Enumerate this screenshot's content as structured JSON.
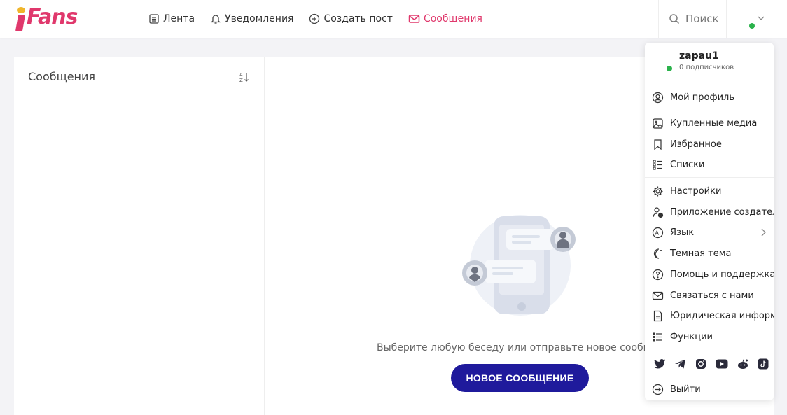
{
  "brand": {
    "logo_text": "Fans",
    "accent": "#e0386c",
    "button_color": "#1f1a9c",
    "online_color": "#2bb24c"
  },
  "nav": {
    "items": [
      {
        "label": "Лента",
        "icon": "feed-icon"
      },
      {
        "label": "Уведомления",
        "icon": "bell-icon"
      },
      {
        "label": "Создать пост",
        "icon": "plus-circle-icon"
      },
      {
        "label": "Сообщения",
        "icon": "envelope-icon",
        "active": true
      }
    ],
    "search_label": "Поиск"
  },
  "messages_panel": {
    "title": "Сообщения"
  },
  "empty_state": {
    "text": "Выберите любую беседу или отправьте новое сообщение",
    "button_label": "НОВОЕ СООБЩЕНИЕ"
  },
  "dropdown": {
    "username": "zapau1",
    "followers": "0 подписчиков",
    "items": [
      {
        "label": "Мой профиль",
        "icon": "profile-icon"
      },
      {
        "label": "Купленные медиа",
        "icon": "media-icon"
      },
      {
        "label": "Избранное",
        "icon": "bookmark-icon"
      },
      {
        "label": "Списки",
        "icon": "list-icon"
      },
      {
        "label": "Настройки",
        "icon": "gear-icon"
      },
      {
        "label": "Приложение создателя",
        "icon": "creator-app-icon"
      },
      {
        "label": "Язык",
        "icon": "language-icon"
      },
      {
        "label": "Темная тема",
        "icon": "moon-icon"
      },
      {
        "label": "Помощь и поддержка",
        "icon": "help-icon"
      },
      {
        "label": "Связаться с нами",
        "icon": "mail-icon"
      },
      {
        "label": "Юридическая информация",
        "icon": "document-icon"
      },
      {
        "label": "Функции",
        "icon": "features-icon"
      },
      {
        "label": "Выйти",
        "icon": "logout-icon"
      }
    ],
    "socials": [
      "twitter-icon",
      "telegram-icon",
      "instagram-icon",
      "youtube-icon",
      "reddit-icon",
      "tiktok-icon"
    ]
  }
}
